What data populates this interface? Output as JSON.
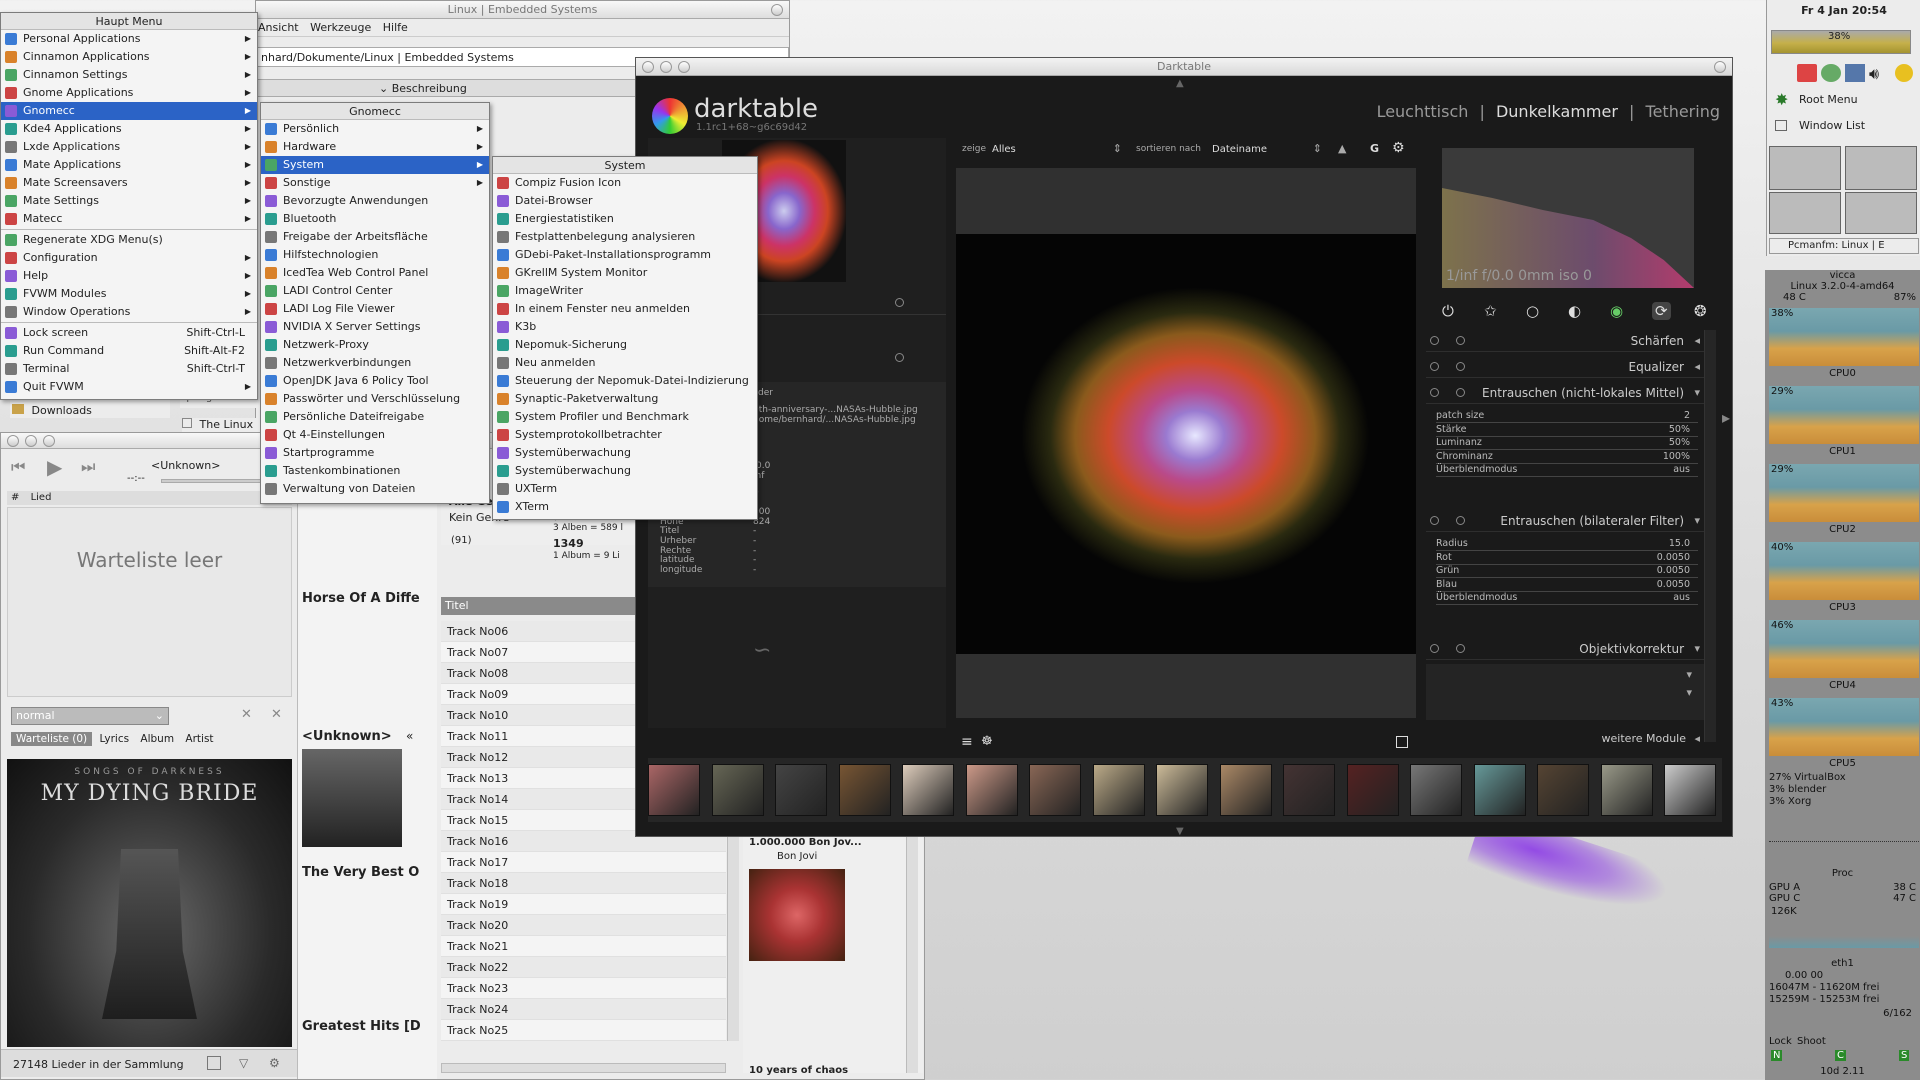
{
  "background_windows": {
    "linux_window_title": "Linux | Embedded Systems",
    "linux_menu": [
      "Ansicht",
      "Werkzeuge",
      "Hilfe"
    ],
    "linux_path": "nhard/Dokumente/Linux | Embedded Systems",
    "beschreibung": "Beschreibung",
    "downloads": "Downloads",
    "sidebar_small": [
      "Springer",
      "The Linux"
    ]
  },
  "haupt_menu": {
    "title": "Haupt Menu",
    "items": [
      {
        "label": "Personal Applications",
        "arrow": true
      },
      {
        "label": "Cinnamon Applications",
        "arrow": true
      },
      {
        "label": "Cinnamon Settings",
        "arrow": true
      },
      {
        "label": "Gnome Applications",
        "arrow": true
      },
      {
        "label": "Gnomecc",
        "arrow": true,
        "selected": true
      },
      {
        "label": "Kde4 Applications",
        "arrow": true
      },
      {
        "label": "Lxde Applications",
        "arrow": true
      },
      {
        "label": "Mate Applications",
        "arrow": true
      },
      {
        "label": "Mate Screensavers",
        "arrow": true
      },
      {
        "label": "Mate Settings",
        "arrow": true
      },
      {
        "label": "Matecc",
        "arrow": true
      }
    ],
    "items2": [
      {
        "label": "Regenerate XDG Menu(s)"
      },
      {
        "label": "Configuration",
        "arrow": true
      },
      {
        "label": "Help",
        "arrow": true
      },
      {
        "label": "FVWM Modules",
        "arrow": true
      },
      {
        "label": "Window Operations",
        "arrow": true
      }
    ],
    "items3": [
      {
        "label": "Lock screen",
        "shortcut": "Shift-Ctrl-L"
      },
      {
        "label": "Run Command",
        "shortcut": "Shift-Alt-F2"
      },
      {
        "label": "Terminal",
        "shortcut": "Shift-Ctrl-T"
      },
      {
        "label": "Quit FVWM",
        "arrow": true
      }
    ]
  },
  "gnomecc_menu": {
    "title": "Gnomecc",
    "items": [
      {
        "label": "Persönlich",
        "arrow": true
      },
      {
        "label": "Hardware",
        "arrow": true
      },
      {
        "label": "System",
        "arrow": true,
        "selected": true
      },
      {
        "label": "Sonstige",
        "arrow": true
      },
      {
        "label": "Bevorzugte Anwendungen"
      },
      {
        "label": "Bluetooth"
      },
      {
        "label": "Freigabe der Arbeitsfläche"
      },
      {
        "label": "Hilfstechnologien"
      },
      {
        "label": "IcedTea Web Control Panel"
      },
      {
        "label": "LADI Control Center"
      },
      {
        "label": "LADI Log File Viewer"
      },
      {
        "label": "NVIDIA X Server Settings"
      },
      {
        "label": "Netzwerk-Proxy"
      },
      {
        "label": "Netzwerkverbindungen"
      },
      {
        "label": "OpenJDK Java 6 Policy Tool"
      },
      {
        "label": "Passwörter und Verschlüsselung"
      },
      {
        "label": "Persönliche Dateifreigabe"
      },
      {
        "label": "Qt 4-Einstellungen"
      },
      {
        "label": "Startprogramme"
      },
      {
        "label": "Tastenkombinationen"
      },
      {
        "label": "Verwaltung von Dateien"
      }
    ]
  },
  "system_menu": {
    "title": "System",
    "items": [
      "Compiz Fusion Icon",
      "Datei-Browser",
      "Energiestatistiken",
      "Festplattenbelegung analysieren",
      "GDebi-Paket-Installationsprogramm",
      "GKrellM System Monitor",
      "ImageWriter",
      "In einem Fenster neu anmelden",
      "K3b",
      "Nepomuk-Sicherung",
      "Neu anmelden",
      "Steuerung der Nepomuk-Datei-Indizierung",
      "Synaptic-Paketverwaltung",
      "System Profiler und Benchmark",
      "Systemprotokollbetrachter",
      "Systemüberwachung",
      "Systemüberwachung",
      "UXTerm",
      "XTerm"
    ]
  },
  "player": {
    "now": "<Unknown>",
    "time": "--:--",
    "column": "Lied",
    "empty_queue": "Warteliste leer",
    "mode": "normal",
    "tabs": [
      "Warteliste (0)",
      "Lyrics",
      "Album",
      "Artist"
    ],
    "album_band": "MY DYING BRIDE",
    "album_sub": "SONGS OF DARKNESS",
    "status": "27148 Lieder in der Sammlung",
    "col2_unknown": "<Unknown>",
    "col2_horse": "Horse Of A Diffe",
    "col2_verybest": "The Very Best O",
    "col2_greatest": "Greatest Hits [D",
    "genre_label": "Alle Ge",
    "genre_kein": "Kein Genre",
    "genre_count": "(91)",
    "year_range": "(2000 - 200",
    "albums": "3 Alben = 589 l",
    "num": "1349",
    "album_line": "1 Album = 9 Li",
    "titel_header": "Titel",
    "tracks": [
      "Track No06",
      "Track No07",
      "Track No08",
      "Track No09",
      "Track No10",
      "Track No11",
      "Track No12",
      "Track No13",
      "Track No14",
      "Track No15",
      "Track No16",
      "Track No17",
      "Track No18",
      "Track No19",
      "Track No20",
      "Track No21",
      "Track No22",
      "Track No23",
      "Track No24",
      "Track No25"
    ],
    "bonjovi_title": "1.000.000 Bon Jov...",
    "bonjovi_artist": "Bon Jovi",
    "bonjovi_sub": "10 years of chaos"
  },
  "darktable": {
    "window_title": "Darktable",
    "logo": "darktable",
    "version": "1.1rc1+68~g6c69d42",
    "nav": [
      "Leuchttisch",
      "|",
      "Dunkelkammer",
      "|",
      "Tethering"
    ],
    "zeige_label": "zeige",
    "zeige_value": "Alles",
    "sort_label": "sortieren nach",
    "sort_value": "Dateiname",
    "histogram_info": "1/inf f/0.0 0mm iso 0",
    "info_files": [
      "ilder",
      "0th-anniversary-...NASAs-Hubble.jpg",
      "nome/bernhard/...NASAs-Hubble.jpg"
    ],
    "info_vals": [
      "/0.0",
      "inf"
    ],
    "meta": [
      {
        "k": "ISO",
        "v": "0"
      },
      {
        "k": "Datum/Uhrzeit",
        "v": ""
      },
      {
        "k": "Breite",
        "v": "900"
      },
      {
        "k": "Höhe",
        "v": "824"
      },
      {
        "k": "Titel",
        "v": "-"
      },
      {
        "k": "Urheber",
        "v": "-"
      },
      {
        "k": "Rechte",
        "v": "-"
      },
      {
        "k": "latitude",
        "v": "-"
      },
      {
        "k": "longitude",
        "v": "-"
      }
    ],
    "modules": {
      "schaerfen": "Schärfen",
      "equalizer": "Equalizer",
      "nlm": "Entrauschen (nicht-lokales Mittel)",
      "bilateral": "Entrauschen (bilateraler Filter)",
      "objektiv": "Objektivkorrektur",
      "more": "weitere Module"
    },
    "nlm_sliders": [
      {
        "k": "patch size",
        "v": "2"
      },
      {
        "k": "Stärke",
        "v": "50%"
      },
      {
        "k": "Luminanz",
        "v": "50%"
      },
      {
        "k": "Chrominanz",
        "v": "100%"
      },
      {
        "k": "Überblendmodus",
        "v": "aus"
      }
    ],
    "bil_sliders": [
      {
        "k": "Radius",
        "v": "15.0"
      },
      {
        "k": "Rot",
        "v": "0.0050"
      },
      {
        "k": "Grün",
        "v": "0.0050"
      },
      {
        "k": "Blau",
        "v": "0.0050"
      },
      {
        "k": "Überblendmodus",
        "v": "aus"
      }
    ]
  },
  "panel_right": {
    "clock": "Fr  4 Jan 20:54",
    "battery": "38%",
    "root_menu": "Root Menu",
    "window_list": "Window List",
    "pager_label": "Pcmanfm: Linux | E"
  },
  "conky": {
    "host": "vicca",
    "kernel": "Linux 3.2.0-4-amd64",
    "temp": "48 C",
    "load": "87%",
    "cpus": [
      {
        "pct": "38%",
        "label": "CPU0"
      },
      {
        "pct": "29%",
        "label": "CPU1"
      },
      {
        "pct": "29%",
        "label": "CPU2"
      },
      {
        "pct": "40%",
        "label": "CPU3"
      },
      {
        "pct": "46%",
        "label": "CPU4"
      },
      {
        "pct": "43%",
        "label": "CPU5"
      }
    ],
    "procs": [
      "27% VirtualBox",
      "3% blender",
      "3% Xorg"
    ],
    "proc_label": "Proc",
    "gpu_a": "GPU A",
    "gpu_a_v": "38 C",
    "gpu_c": "GPU C",
    "gpu_c_v": "47 C",
    "net_rate": "126K",
    "eth": "eth1",
    "eth_val": "0.00 00",
    "mem1": "16047M - 11620M frei",
    "mem2": "15259M - 15253M frei",
    "cnt": "6/162",
    "lock": "Lock",
    "shoot": "Shoot",
    "letters": [
      "N",
      "C",
      "S"
    ],
    "uptime": "10d 2.11"
  }
}
